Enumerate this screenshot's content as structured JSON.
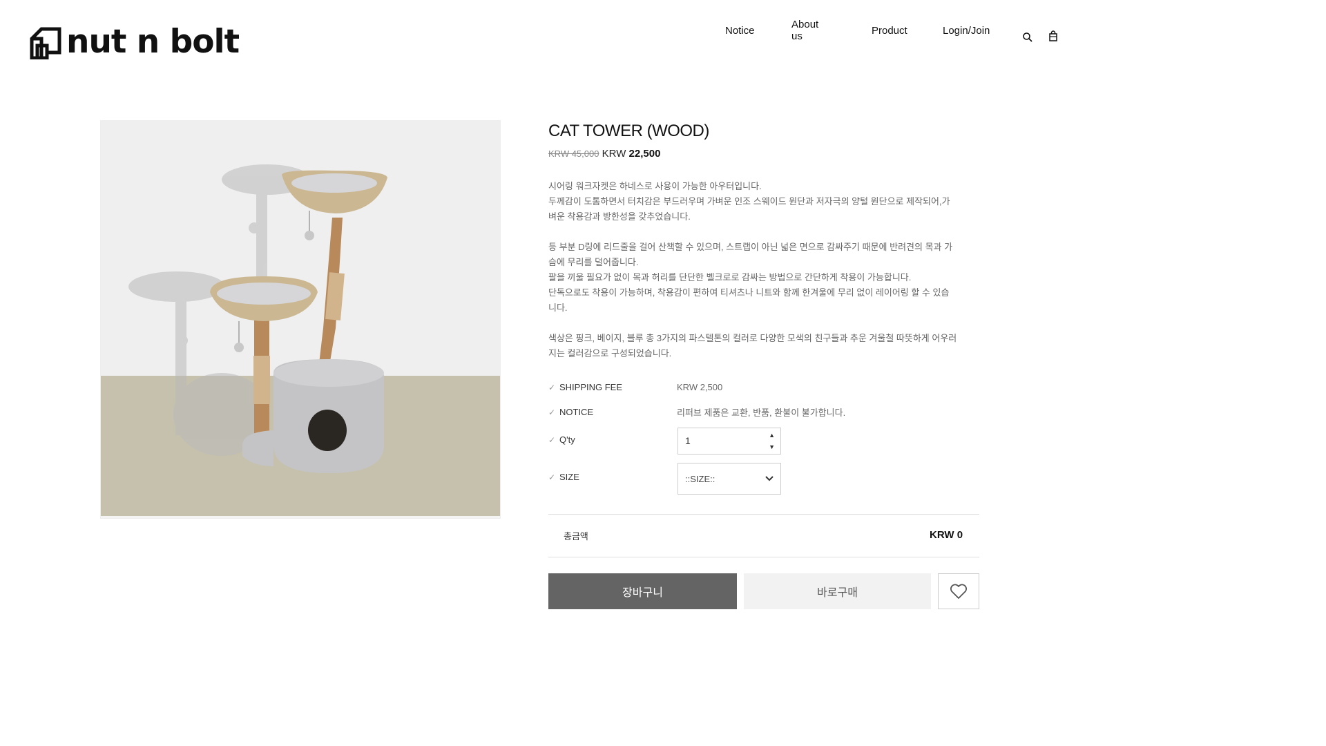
{
  "brand": {
    "name": "nut n bolt",
    "icon": "house-logo-icon"
  },
  "nav": {
    "items": [
      {
        "label": "Notice"
      },
      {
        "label": "About us"
      },
      {
        "label": "Product"
      },
      {
        "label": "Login/Join"
      }
    ],
    "search_icon": "search-icon",
    "cart_icon": "shopping-bag-icon"
  },
  "product": {
    "title": "CAT TOWER (WOOD)",
    "price_original": "KRW 45,000",
    "price_prefix": "KRW ",
    "price_sale": "22,500",
    "description": [
      [
        "시어링 워크자켓은 하네스로 사용이 가능한 아우터입니다.",
        "두께감이 도톰하면서 터치감은 부드러우며 가벼운 인조 스웨이드 원단과 저자극의 양털 원단으로 제작되어,가",
        "벼운 착용감과 방한성을 갖추었습니다."
      ],
      [
        "등 부분 D링에 리드줄을 걸어 산책할 수 있으며, 스트랩이 아닌 넓은 면으로 감싸주기 때문에 반려견의 목과 가",
        "슴에 무리를 덜어줍니다.",
        "팔을 끼울 필요가 없이 목과 허리를 단단한 벨크로로 감싸는 방법으로 간단하게 착용이 가능합니다.",
        "단독으로도 착용이 가능하며, 착용감이 편하여 티셔츠나 니트와 함께 한겨울에 무리 없이 레이어링 할 수 있습",
        "니다."
      ],
      [
        "색상은 핑크, 베이지, 블루 총 3가지의 파스텔톤의 컬러로 다양한 모색의 친구들과 추운 겨울철 따뜻하게 어우러",
        "지는 컬러감으로 구성되었습니다."
      ]
    ]
  },
  "options": {
    "shipping_label": "SHIPPING FEE",
    "shipping_value": "KRW 2,500",
    "notice_label": "NOTICE",
    "notice_value": "리퍼브 제품은 교환, 반품, 환불이 불가합니다.",
    "qty_label": "Q'ty",
    "qty_value": "1",
    "size_label": "SIZE",
    "size_selected": "::SIZE::"
  },
  "total": {
    "label": "총금액",
    "value": "KRW 0"
  },
  "actions": {
    "cart_label": "장바구니",
    "buy_label": "바로구매",
    "wish_icon": "heart-icon"
  }
}
